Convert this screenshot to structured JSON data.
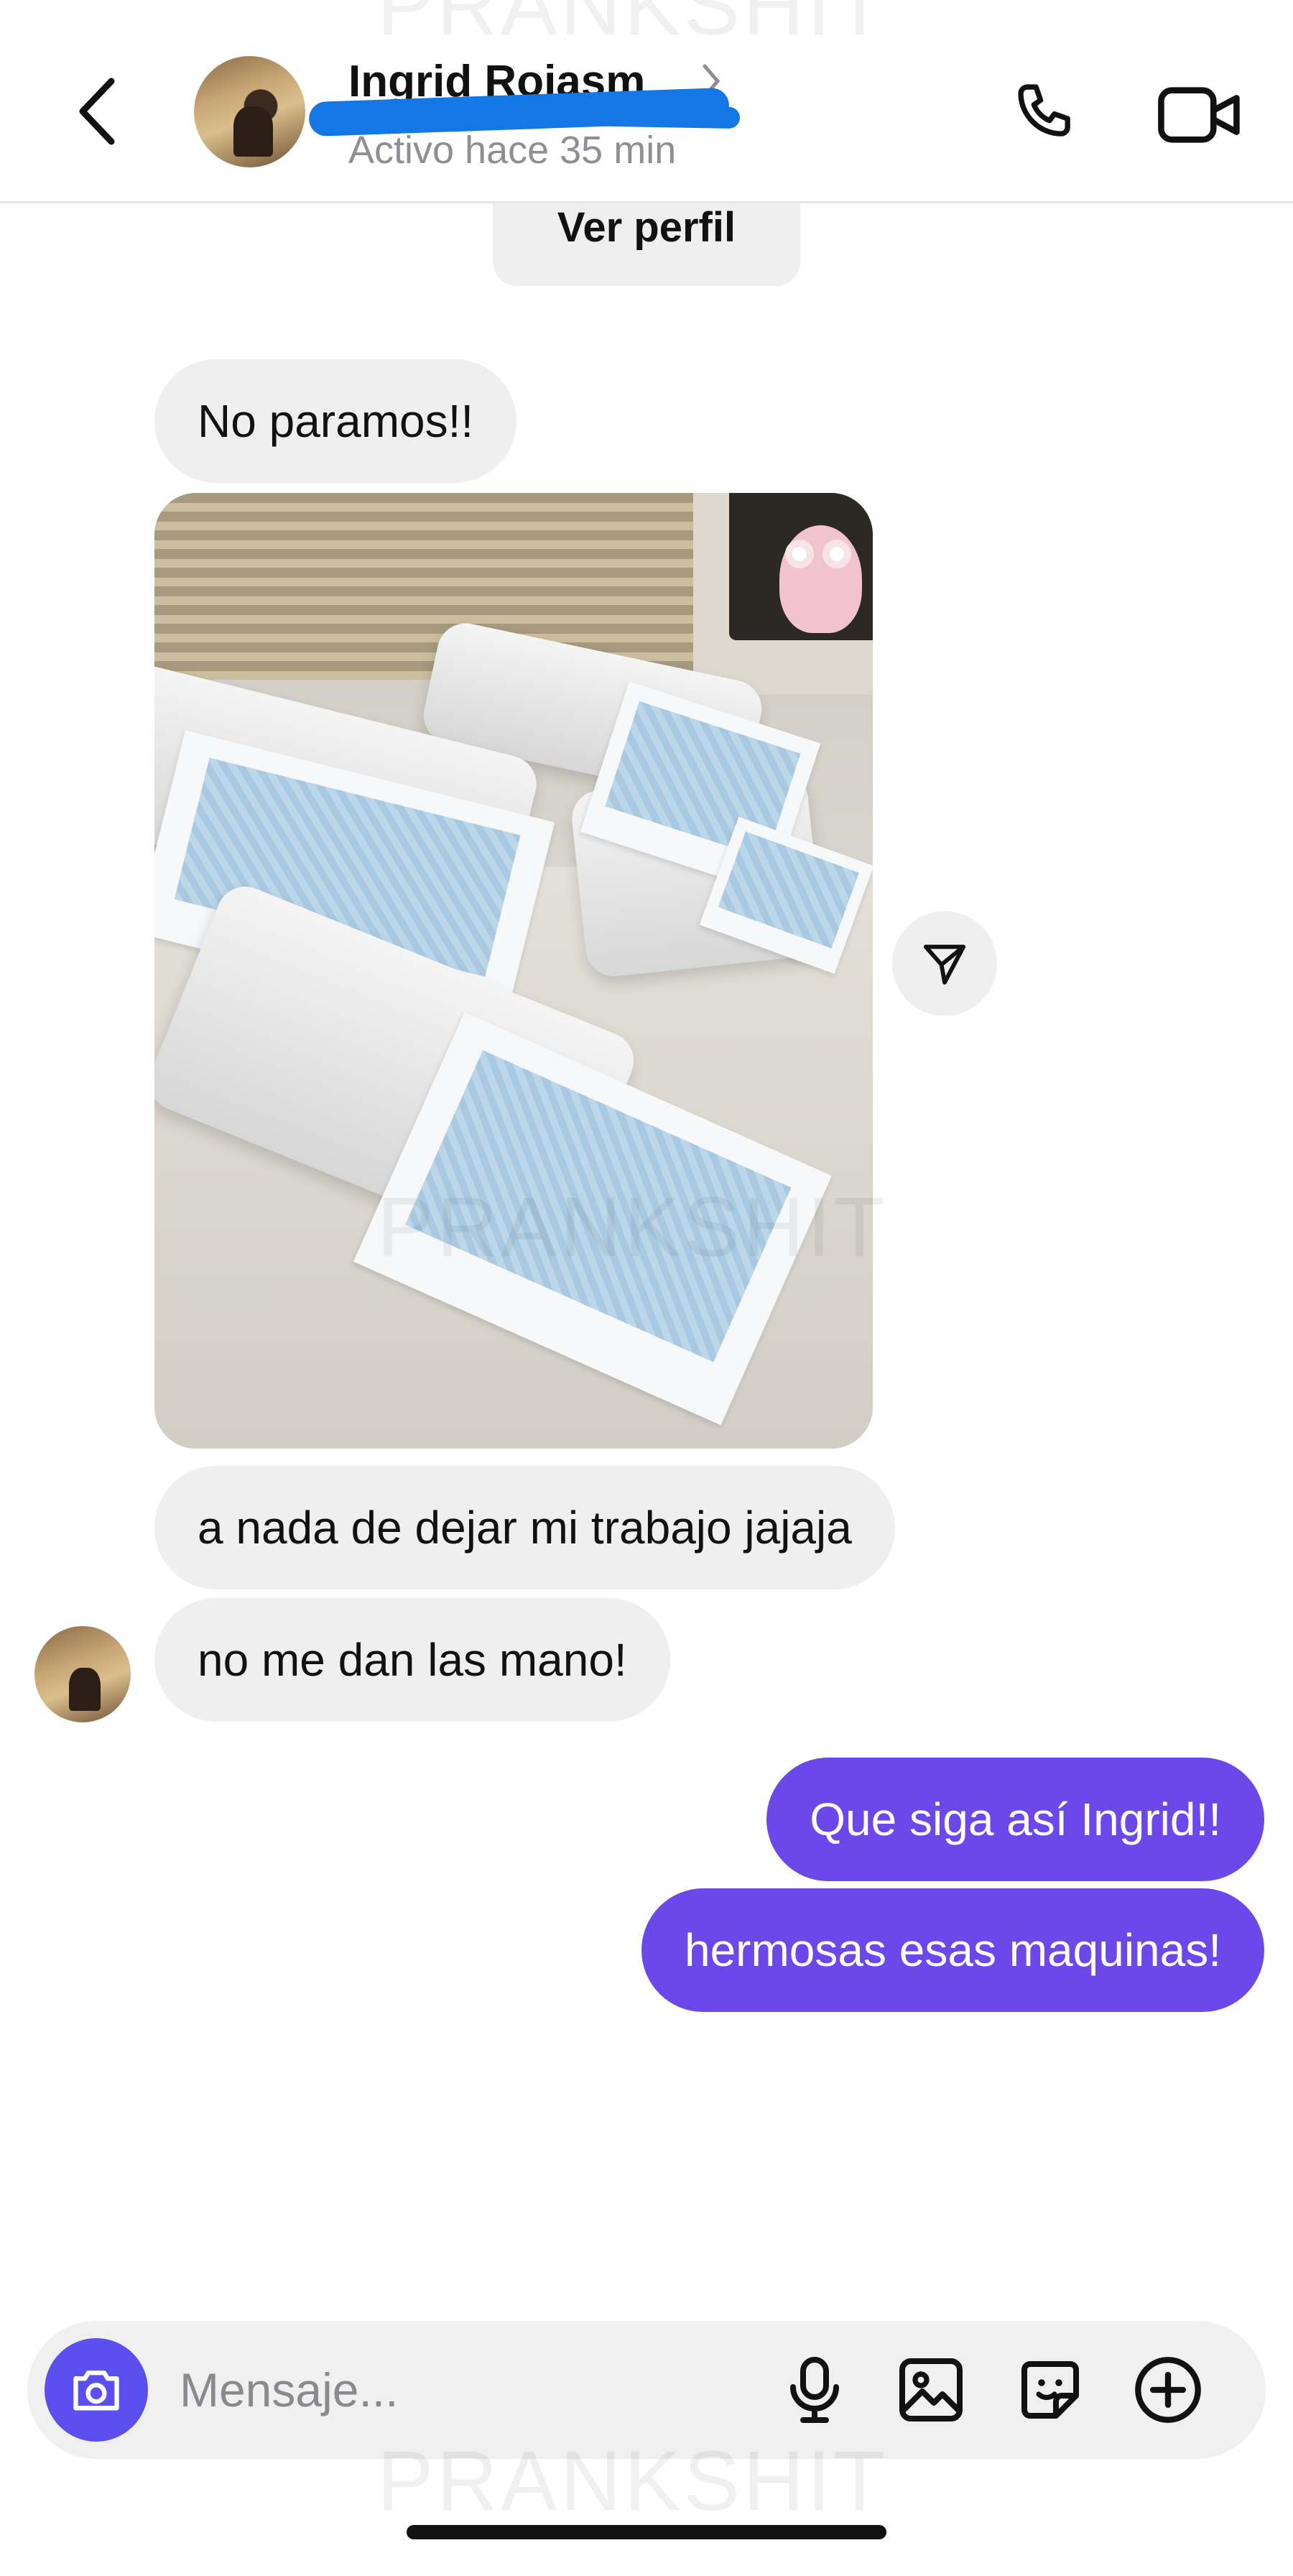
{
  "header": {
    "contact_name": "Ingrid Rojasm",
    "status": "Activo hace 35 min",
    "back_icon": "chevron-left-icon",
    "call_icon": "phone-icon",
    "video_icon": "video-camera-icon"
  },
  "profile_button": "Ver perfil",
  "messages": [
    {
      "direction": "incoming",
      "text": "No paramos!!"
    },
    {
      "direction": "incoming",
      "type": "photo"
    },
    {
      "direction": "incoming",
      "text": "a nada de dejar mi trabajo jajaja"
    },
    {
      "direction": "incoming",
      "text": "no me dan las mano!"
    },
    {
      "direction": "outgoing",
      "text": "Que siga así Ingrid!!"
    },
    {
      "direction": "outgoing",
      "text": "hermosas esas maquinas!"
    }
  ],
  "share_icon": "send-icon",
  "composer": {
    "placeholder": "Mensaje...",
    "icons": [
      "camera-icon",
      "microphone-icon",
      "image-icon",
      "sticker-icon",
      "plus-circle-icon"
    ]
  },
  "watermark": "PRANKSHIT",
  "colors": {
    "outgoing_bubble": "#6c47ea",
    "incoming_bubble": "#efefef",
    "camera_button": "#5b4ff0",
    "redaction": "#1477e6"
  }
}
